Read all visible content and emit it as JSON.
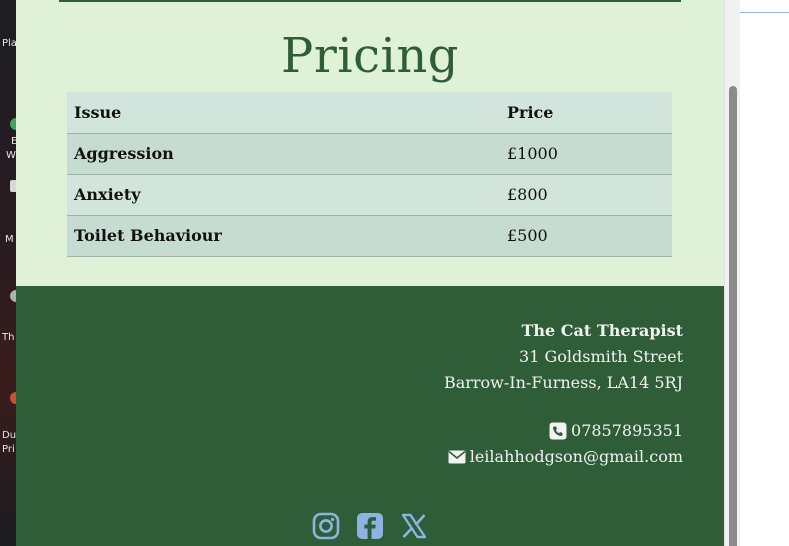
{
  "desktop": {
    "labels": [
      "Pla",
      "E",
      "W",
      "M",
      "Th",
      "Du",
      "Pri"
    ]
  },
  "page": {
    "title": "Pricing",
    "table": {
      "headers": [
        "Issue",
        "Price"
      ],
      "rows": [
        {
          "issue": "Aggression",
          "price": "£1000"
        },
        {
          "issue": "Anxiety",
          "price": "£800"
        },
        {
          "issue": "Toilet Behaviour",
          "price": "£500"
        }
      ]
    }
  },
  "footer": {
    "business_name": "The Cat Therapist",
    "address_line1": "31 Goldsmith Street",
    "address_line2": "Barrow-In-Furness, LA14 5RJ",
    "phone": "07857895351",
    "email": "leilahhodgson@gmail.com",
    "social_icons": [
      "instagram-icon",
      "facebook-icon",
      "x-icon"
    ]
  },
  "colors": {
    "page_bg": "#dff2d8",
    "accent_green": "#2f5d38",
    "social_icon": "#8fb3e0",
    "table_row_a": "#d1e5dc",
    "table_row_b": "#c6dbd2"
  }
}
